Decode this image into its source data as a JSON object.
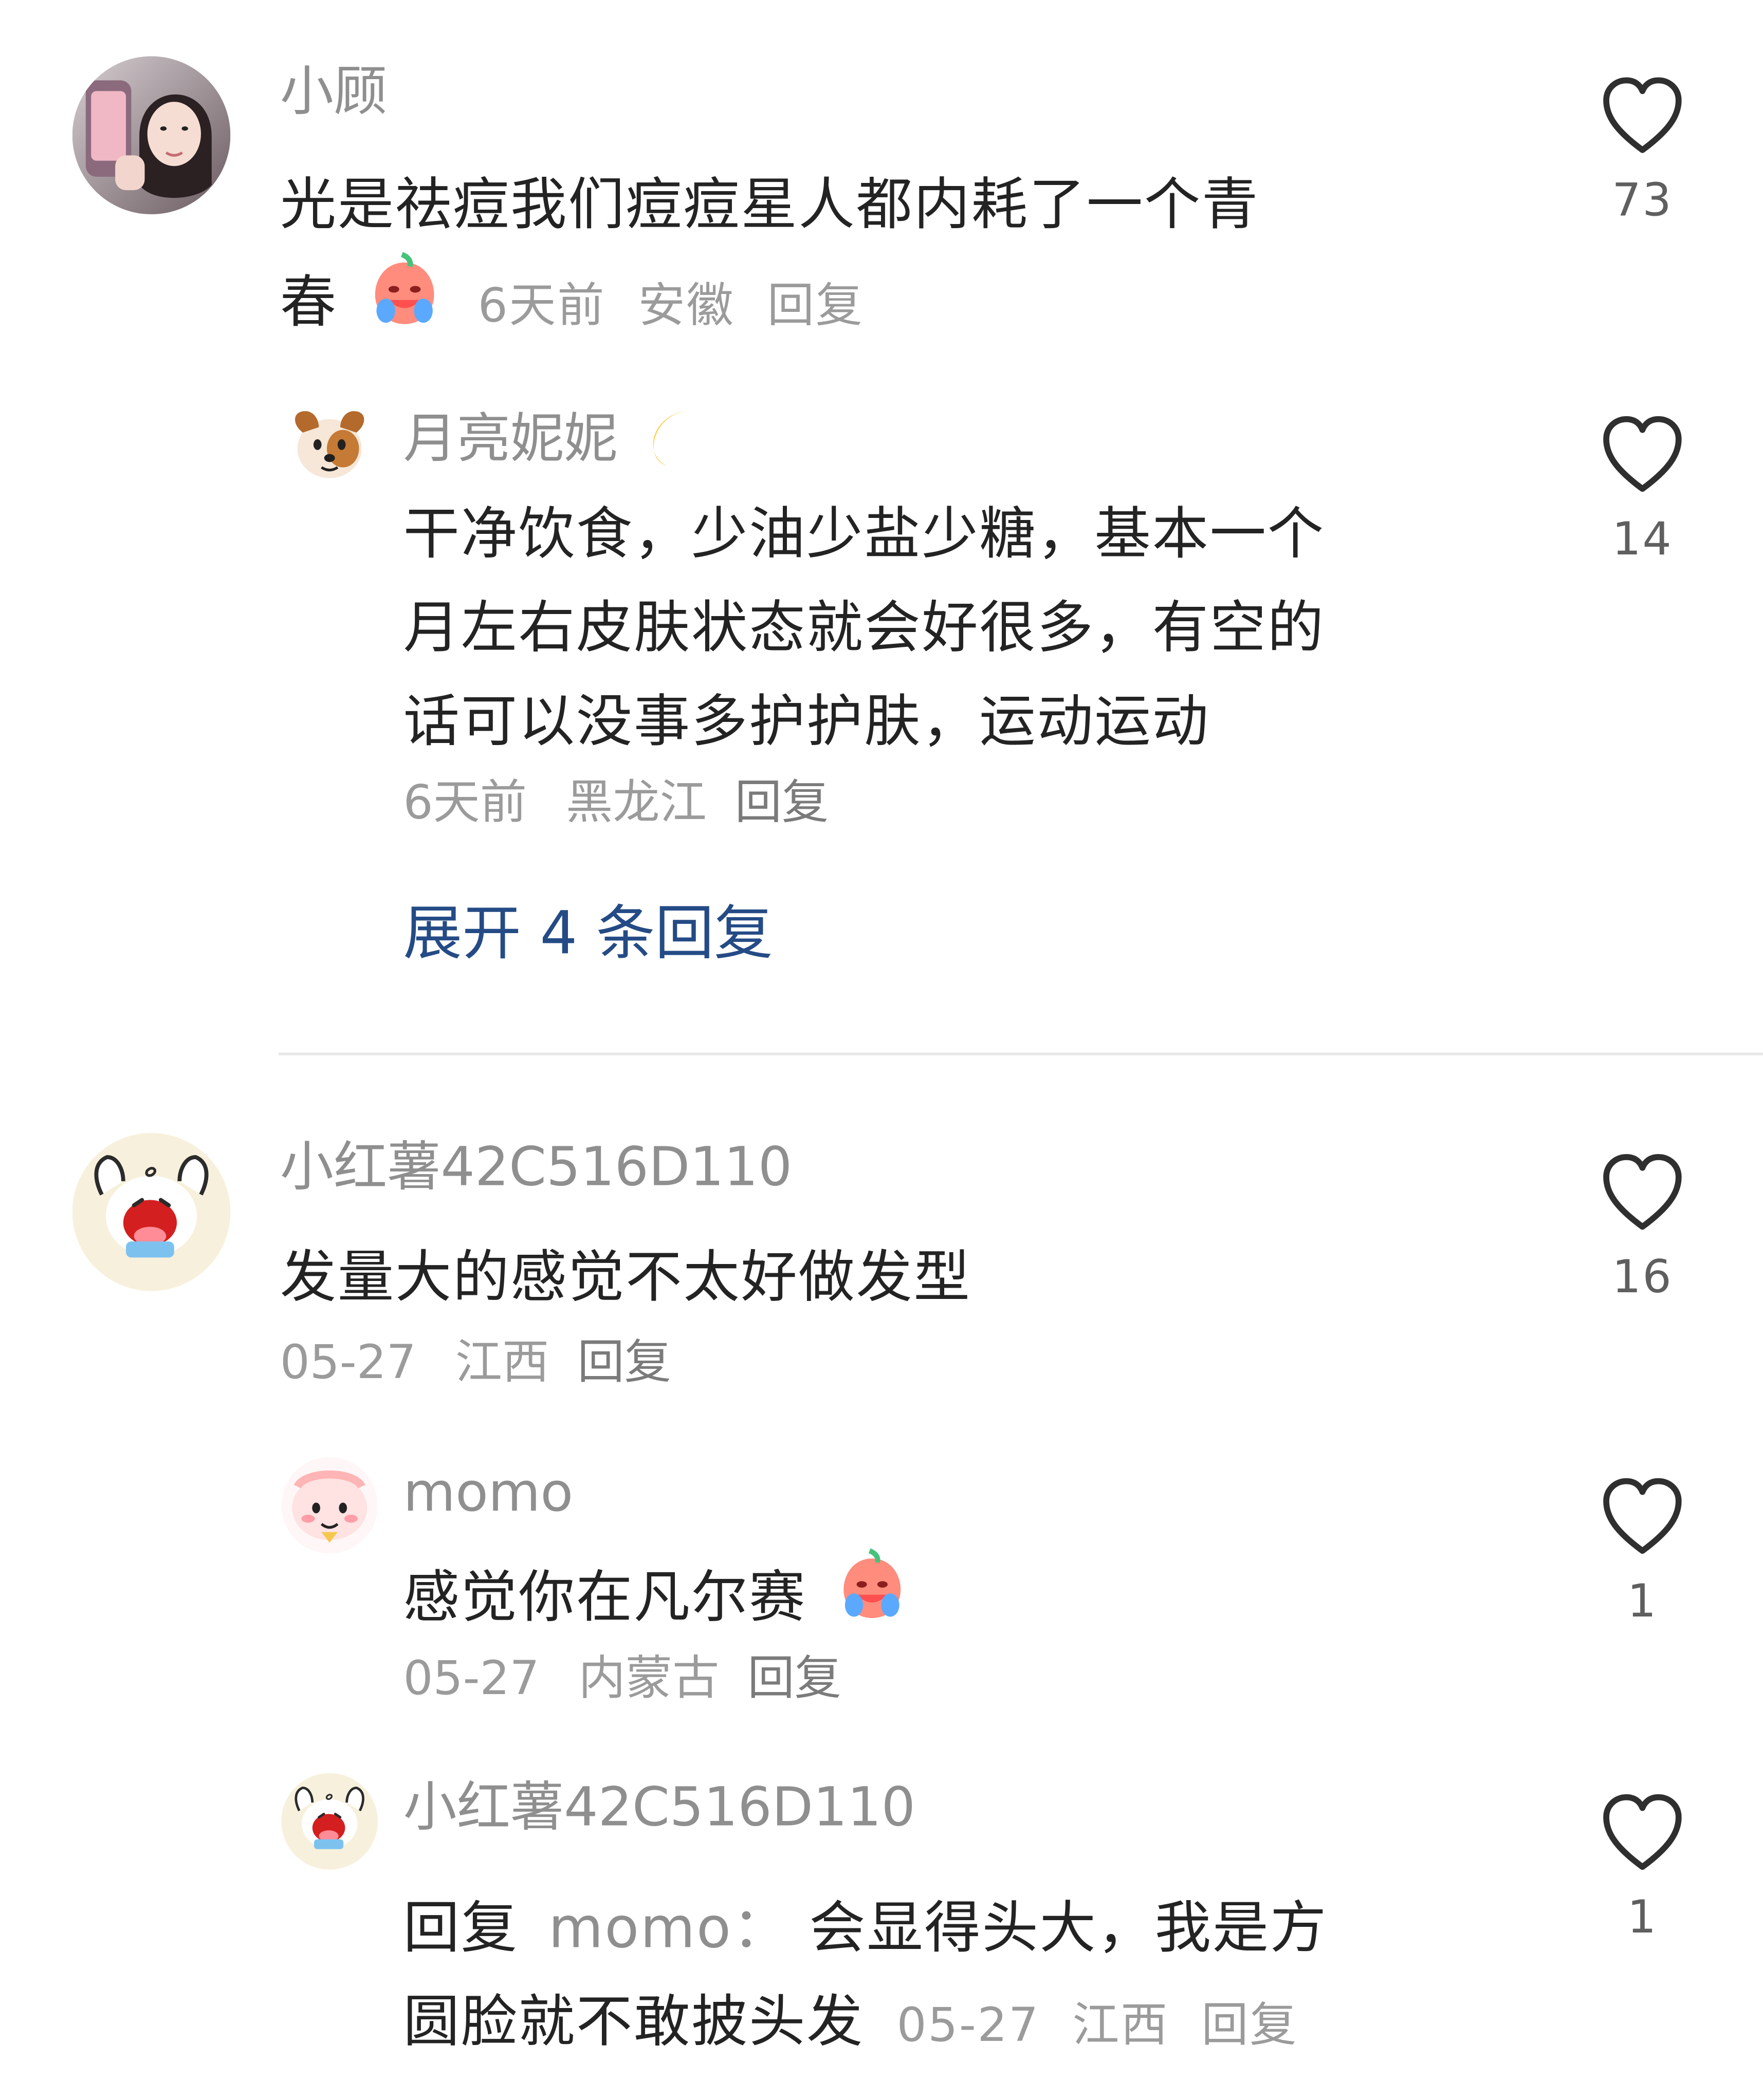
{
  "comments": [
    {
      "username": "小顾",
      "text_lines": [
        "光是祛痘我们痘痘星人都内耗了一个青",
        "春"
      ],
      "time": "6天前",
      "location": "安徽",
      "reply_label": "回复",
      "likes": "73",
      "avatar_icon": "woman-selfie-avatar-icon"
    },
    {
      "username": "月亮妮妮",
      "text_lines": [
        "干净饮食，少油少盐少糖，基本一个",
        "月左右皮肤状态就会好很多，有空的",
        "话可以没事多护护肤，运动运动"
      ],
      "time": "6天前",
      "location": "黑龙江",
      "reply_label": "回复",
      "likes": "14",
      "avatar_icon": "puppy-avatar-icon"
    },
    {
      "expand_label": "展开 4 条回复"
    },
    {
      "username": "小红薯42C516D110",
      "text_lines": [
        "发量大的感觉不太好做发型"
      ],
      "time": "05-27",
      "location": "江西",
      "reply_label": "回复",
      "likes": "16",
      "avatar_icon": "cartoon-bunny-avatar-icon"
    },
    {
      "username": "momo",
      "text_lines": [
        "感觉你在凡尔赛"
      ],
      "time": "05-27",
      "location": "内蒙古",
      "reply_label": "回复",
      "likes": "1",
      "avatar_icon": "pink-blob-avatar-icon"
    },
    {
      "username": "小红薯42C516D110",
      "reply_prefix": "回复",
      "reply_target": "momo：",
      "text_lines": [
        "会显得头大，我是方",
        "圆脸就不敢披头发"
      ],
      "time": "05-27",
      "location": "江西",
      "reply_label": "回复",
      "likes": "1",
      "avatar_icon": "cartoon-bunny-avatar-icon"
    }
  ],
  "colors": {
    "username": "#8f8f8f",
    "text": "#232323",
    "meta": "#9b9b9b",
    "expand": "#244b85",
    "divider": "#e7e7e7",
    "heart_outline": "#2f2f2f"
  }
}
